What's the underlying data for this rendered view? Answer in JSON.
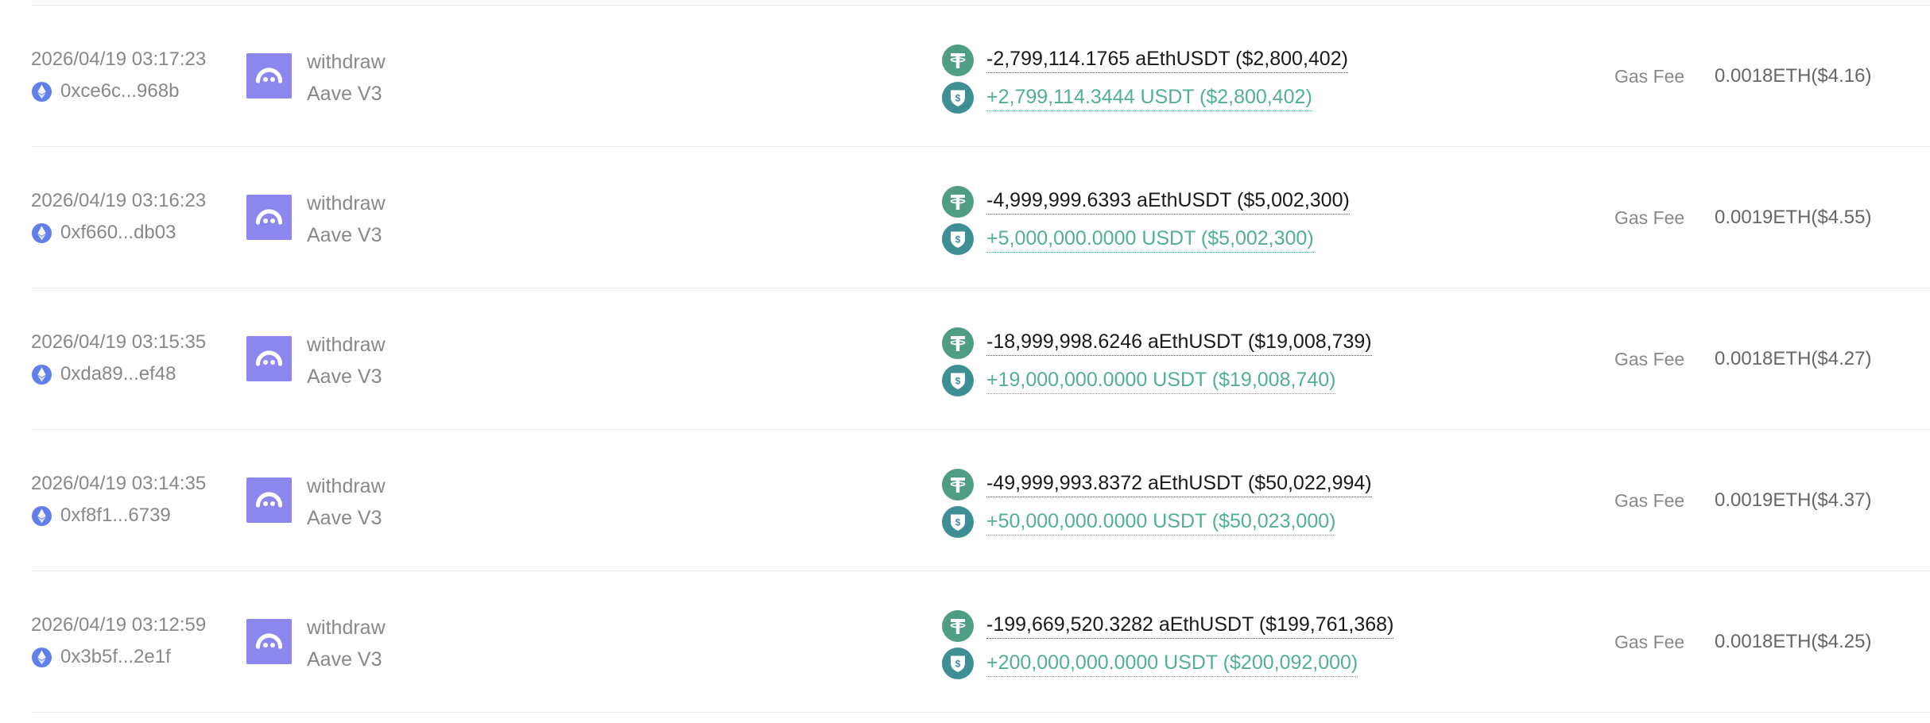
{
  "colors": {
    "protocol_logo": "#8b87ee",
    "eth_icon": "#627eea",
    "aethusdt_icon": "#4f9d84",
    "usdt_icon": "#3d8e95",
    "incoming_amount": "#52b08f",
    "muted_text": "#888888"
  },
  "icons": {
    "chain": "ethereum-icon",
    "protocol": "aave-ghost-icon",
    "token_out": "aethusdt-tether-icon",
    "token_in": "usdt-shield-icon"
  },
  "transactions": [
    {
      "time": "2026/04/19 03:17:23",
      "hash": "0xce6c...968b",
      "method": "withdraw",
      "protocol": "Aave V3",
      "amount_out": "-2,799,114.1765 aEthUSDT ($2,800,402)",
      "amount_in": "+2,799,114.3444 USDT ($2,800,402)",
      "gas_label": "Gas Fee",
      "gas_value": "0.0018ETH($4.16)"
    },
    {
      "time": "2026/04/19 03:16:23",
      "hash": "0xf660...db03",
      "method": "withdraw",
      "protocol": "Aave V3",
      "amount_out": "-4,999,999.6393 aEthUSDT ($5,002,300)",
      "amount_in": "+5,000,000.0000 USDT ($5,002,300)",
      "gas_label": "Gas Fee",
      "gas_value": "0.0019ETH($4.55)"
    },
    {
      "time": "2026/04/19 03:15:35",
      "hash": "0xda89...ef48",
      "method": "withdraw",
      "protocol": "Aave V3",
      "amount_out": "-18,999,998.6246 aEthUSDT ($19,008,739)",
      "amount_in": "+19,000,000.0000 USDT ($19,008,740)",
      "gas_label": "Gas Fee",
      "gas_value": "0.0018ETH($4.27)"
    },
    {
      "time": "2026/04/19 03:14:35",
      "hash": "0xf8f1...6739",
      "method": "withdraw",
      "protocol": "Aave V3",
      "amount_out": "-49,999,993.8372 aEthUSDT ($50,022,994)",
      "amount_in": "+50,000,000.0000 USDT ($50,023,000)",
      "gas_label": "Gas Fee",
      "gas_value": "0.0019ETH($4.37)"
    },
    {
      "time": "2026/04/19 03:12:59",
      "hash": "0x3b5f...2e1f",
      "method": "withdraw",
      "protocol": "Aave V3",
      "amount_out": "-199,669,520.3282 aEthUSDT ($199,761,368)",
      "amount_in": "+200,000,000.0000 USDT ($200,092,000)",
      "gas_label": "Gas Fee",
      "gas_value": "0.0018ETH($4.25)"
    }
  ]
}
